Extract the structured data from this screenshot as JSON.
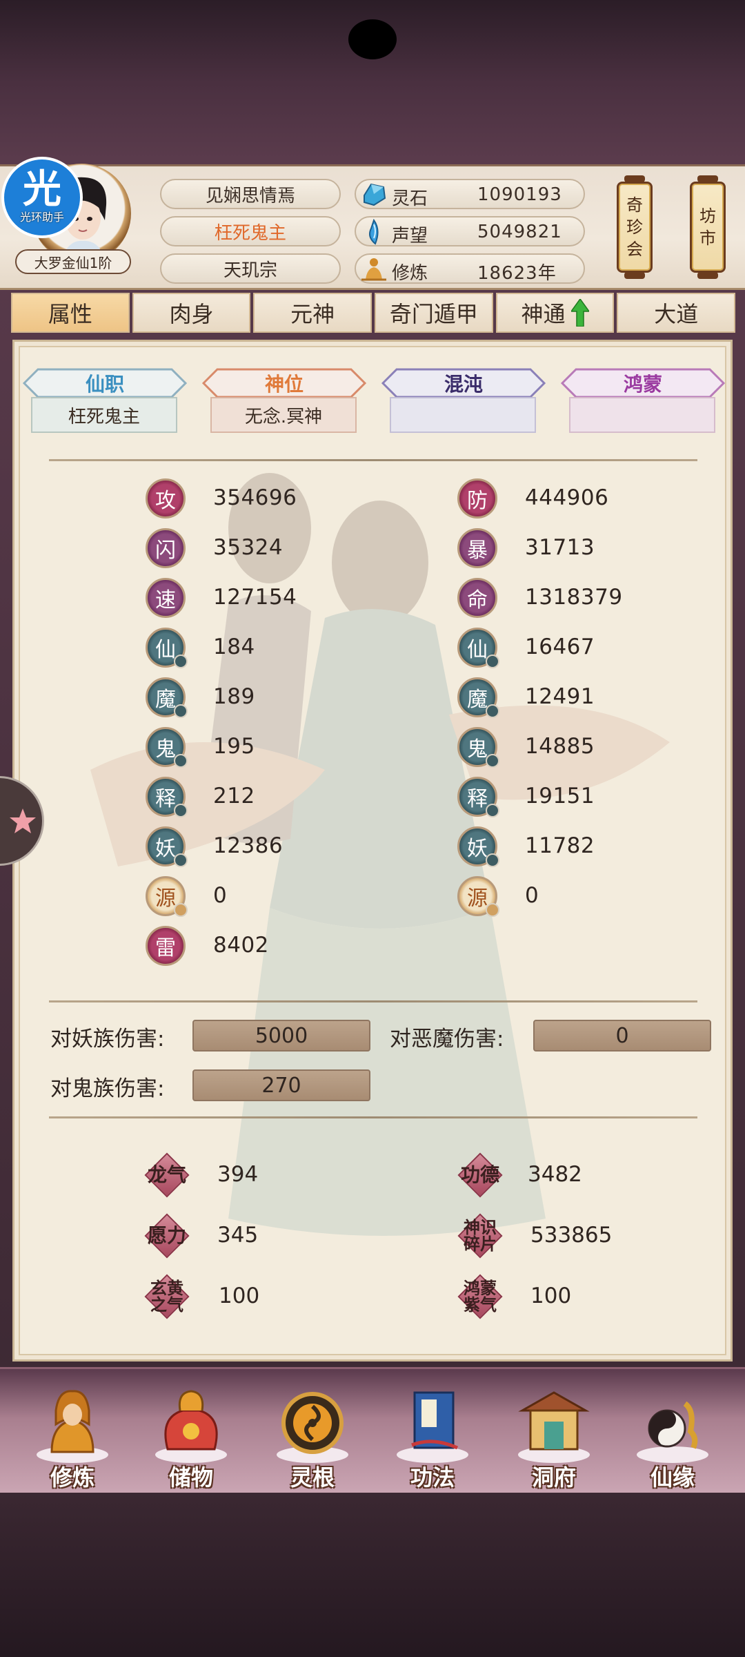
{
  "helper_badge": {
    "char": "光",
    "label": "光环助手"
  },
  "player": {
    "realm": "大罗金仙1阶",
    "name": "见娴思情焉",
    "title": "枉死鬼主",
    "sect": "天玑宗"
  },
  "resources": [
    {
      "label": "灵石",
      "value": "1090193",
      "icon": "spirit-stone-icon"
    },
    {
      "label": "声望",
      "value": "5049821",
      "icon": "reputation-icon"
    },
    {
      "label": "修炼",
      "value": "18623年",
      "icon": "cultivation-icon"
    }
  ],
  "lanterns": [
    {
      "chars": [
        "奇",
        "珍",
        "会"
      ]
    },
    {
      "chars": [
        "坊",
        "市"
      ]
    }
  ],
  "tabs": [
    {
      "label": "属性",
      "active": true
    },
    {
      "label": "肉身",
      "active": false
    },
    {
      "label": "元神",
      "active": false
    },
    {
      "label": "奇门遁甲",
      "active": false
    },
    {
      "label": "神通",
      "active": false,
      "badge": "up-arrow-icon"
    },
    {
      "label": "大道",
      "active": false
    }
  ],
  "ranks": [
    {
      "label": "仙职",
      "value": "枉死鬼主",
      "color": "#3a8fc0"
    },
    {
      "label": "神位",
      "value": "无念.冥神",
      "color": "#e07a3a"
    },
    {
      "label": "混沌",
      "value": "",
      "color": "#3a2c6a"
    },
    {
      "label": "鸿蒙",
      "value": "",
      "color": "#9a3aa0"
    }
  ],
  "stats_left": [
    {
      "glyph": "攻",
      "value": "354696",
      "style": "red"
    },
    {
      "glyph": "闪",
      "value": "35324",
      "style": "purple"
    },
    {
      "glyph": "速",
      "value": "127154",
      "style": "purple"
    },
    {
      "glyph": "仙",
      "value": "184",
      "style": "teal"
    },
    {
      "glyph": "魔",
      "value": "189",
      "style": "teal"
    },
    {
      "glyph": "鬼",
      "value": "195",
      "style": "teal"
    },
    {
      "glyph": "释",
      "value": "212",
      "style": "teal"
    },
    {
      "glyph": "妖",
      "value": "12386",
      "style": "teal"
    },
    {
      "glyph": "源",
      "value": "0",
      "style": "gold"
    },
    {
      "glyph": "雷",
      "value": "8402",
      "style": "red"
    }
  ],
  "stats_right": [
    {
      "glyph": "防",
      "value": "444906",
      "style": "red"
    },
    {
      "glyph": "暴",
      "value": "31713",
      "style": "purple"
    },
    {
      "glyph": "命",
      "value": "1318379",
      "style": "purple"
    },
    {
      "glyph": "仙",
      "value": "16467",
      "style": "teal"
    },
    {
      "glyph": "魔",
      "value": "12491",
      "style": "teal"
    },
    {
      "glyph": "鬼",
      "value": "14885",
      "style": "teal"
    },
    {
      "glyph": "释",
      "value": "19151",
      "style": "teal"
    },
    {
      "glyph": "妖",
      "value": "11782",
      "style": "teal"
    },
    {
      "glyph": "源",
      "value": "0",
      "style": "gold"
    }
  ],
  "damage": [
    {
      "label": "对妖族伤害:",
      "value": "5000"
    },
    {
      "label": "对恶魔伤害:",
      "value": "0"
    },
    {
      "label": "对鬼族伤害:",
      "value": "270"
    }
  ],
  "special": [
    {
      "label": "龙气",
      "value": "394"
    },
    {
      "label": "功德",
      "value": "3482"
    },
    {
      "label": "愿力",
      "value": "345"
    },
    {
      "label": "神识碎片",
      "value": "533865"
    },
    {
      "label": "玄黄之气",
      "value": "100"
    },
    {
      "label": "鸿蒙紫气",
      "value": "100"
    }
  ],
  "bottom_nav": [
    {
      "label": "修炼",
      "icon": "cultivate-monk-icon"
    },
    {
      "label": "储物",
      "icon": "storage-bag-icon"
    },
    {
      "label": "灵根",
      "icon": "spirit-root-icon"
    },
    {
      "label": "功法",
      "icon": "skill-book-icon"
    },
    {
      "label": "洞府",
      "icon": "cave-dwelling-icon"
    },
    {
      "label": "仙缘",
      "icon": "immortal-fate-icon"
    }
  ]
}
